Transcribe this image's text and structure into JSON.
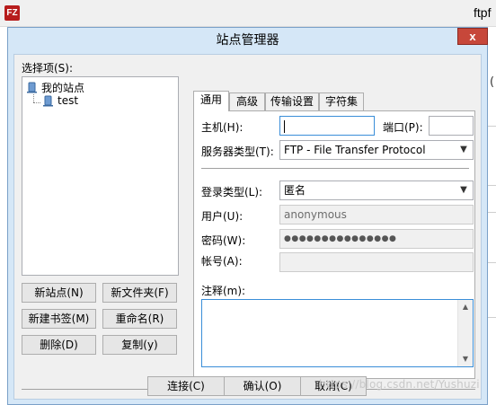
{
  "background_app": {
    "logo": "FZ",
    "title_fragment": "ftpf",
    "edge_fragment": "("
  },
  "dialog": {
    "title": "站点管理器",
    "close_glyph": "x"
  },
  "left_panel": {
    "select_label": "选择项(S):",
    "tree": {
      "root": "我的站点",
      "child": "test"
    },
    "buttons": {
      "new_site": "新站点(N)",
      "new_folder": "新文件夹(F)",
      "new_bookmark": "新建书签(M)",
      "rename": "重命名(R)",
      "delete": "删除(D)",
      "copy": "复制(y)"
    }
  },
  "tabs": [
    "通用",
    "高级",
    "传输设置",
    "字符集"
  ],
  "general": {
    "host_label": "主机(H):",
    "host_value": "",
    "port_label": "端口(P):",
    "port_value": "",
    "server_type_label": "服务器类型(T):",
    "server_type_value": "FTP - File Transfer Protocol",
    "login_type_label": "登录类型(L):",
    "login_type_value": "匿名",
    "user_label": "用户(U):",
    "user_value": "anonymous",
    "password_label": "密码(W):",
    "password_value": "●●●●●●●●●●●●●●●",
    "account_label": "帐号(A):",
    "account_value": "",
    "comment_label": "注释(m):",
    "comment_value": ""
  },
  "footer": {
    "connect": "连接(C)",
    "ok": "确认(O)",
    "cancel": "取消(C)"
  },
  "watermark": "https://blog.csdn.net/Yushuzi",
  "colors": {
    "dialog_frame": "#d5e7f7",
    "close_button": "#c7473a",
    "focus_border": "#3a8ed8"
  }
}
